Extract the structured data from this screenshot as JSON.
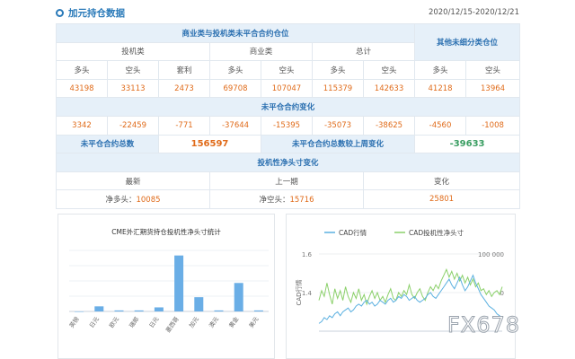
{
  "header": {
    "title": "加元持仓数据",
    "date_range": "2020/12/15-2020/12/21"
  },
  "table": {
    "section1": "商业类与投机类未平合合约仓位",
    "section_other": "其他未细分类仓位",
    "groups": [
      "投机类",
      "商业类",
      "总计"
    ],
    "columns": [
      "多头",
      "空头",
      "套利",
      "多头",
      "空头",
      "多头",
      "空头",
      "多头",
      "空头"
    ],
    "values": [
      "43198",
      "33113",
      "2473",
      "69708",
      "107047",
      "115379",
      "142633",
      "41218",
      "13964"
    ],
    "section2": "未平仓合约变化",
    "changes": [
      "3342",
      "-22459",
      "-771",
      "-37644",
      "-15395",
      "-35073",
      "-38625",
      "-4560",
      "-1008"
    ],
    "total_label": "未平仓合约总数",
    "total_value": "156597",
    "weekly_change_label": "未平仓合约总数较上周变化",
    "weekly_change_value": "-39633",
    "section3": "投机性净头寸变化",
    "net_headers": [
      "最新",
      "上一期",
      "变化"
    ],
    "net_latest_label": "净多头：",
    "net_latest_value": "10085",
    "net_prev_label": "净空头：",
    "net_prev_value": "15716",
    "net_change_value": "25801"
  },
  "colors": {
    "accent": "#2a7ab9",
    "orange": "#e06b1a",
    "green": "#3a9e62",
    "bar": "#6aaee6",
    "line_cad": "#5bb0e0",
    "line_net": "#8bd06a"
  },
  "chart_data": [
    {
      "type": "bar",
      "title": "CME外汇期货持仓投机性净头寸统计",
      "categories": [
        "英镑",
        "日元",
        "欧元",
        "瑞郎",
        "日元",
        "墨西哥",
        "加元",
        "澳元",
        "黄金",
        "美元"
      ],
      "values": [
        0,
        5,
        1,
        1,
        4,
        55,
        14,
        1,
        28,
        1
      ],
      "ylim": [
        0,
        60
      ]
    },
    {
      "type": "line",
      "series_names": [
        "CAD行情",
        "CAD投机性净头寸"
      ],
      "y_left_ticks": [
        "1.6",
        "1.4"
      ],
      "y_left_label": "CAD行情",
      "y_right_ticks": [
        "100 000",
        "0"
      ],
      "y_left_range": [
        1.2,
        1.6
      ],
      "y_right_range": [
        -100000,
        100000
      ],
      "cad": [
        1.24,
        1.25,
        1.27,
        1.26,
        1.28,
        1.27,
        1.29,
        1.3,
        1.28,
        1.3,
        1.31,
        1.32,
        1.3,
        1.31,
        1.33,
        1.34,
        1.33,
        1.35,
        1.36,
        1.34,
        1.35,
        1.33,
        1.34,
        1.36,
        1.35,
        1.34,
        1.36,
        1.37,
        1.35,
        1.36,
        1.38,
        1.37,
        1.39,
        1.38,
        1.36,
        1.37,
        1.38,
        1.36,
        1.35,
        1.36,
        1.37,
        1.39,
        1.4,
        1.38,
        1.37,
        1.39,
        1.41,
        1.43,
        1.45,
        1.47,
        1.44,
        1.42,
        1.45,
        1.48,
        1.44,
        1.41,
        1.43,
        1.46,
        1.49,
        1.45,
        1.42,
        1.39,
        1.37,
        1.35,
        1.33,
        1.32,
        1.31,
        1.29,
        1.28,
        1.27
      ],
      "net": [
        -20000,
        5000,
        -10000,
        25000,
        -5000,
        -30000,
        10000,
        -15000,
        5000,
        -20000,
        15000,
        -10000,
        -25000,
        0,
        -15000,
        10000,
        -20000,
        -5000,
        -30000,
        -10000,
        5000,
        -15000,
        0,
        -20000,
        -10000,
        -25000,
        -5000,
        10000,
        -15000,
        -20000,
        0,
        -10000,
        5000,
        -5000,
        20000,
        -5000,
        -15000,
        0,
        10000,
        -10000,
        -20000,
        0,
        15000,
        5000,
        20000,
        10000,
        30000,
        45000,
        60000,
        40000,
        55000,
        35000,
        50000,
        30000,
        45000,
        25000,
        40000,
        20000,
        35000,
        15000,
        25000,
        5000,
        10000,
        -5000,
        5000,
        -10000,
        0,
        5000,
        -5000,
        15000
      ]
    }
  ],
  "watermark": "FX678"
}
